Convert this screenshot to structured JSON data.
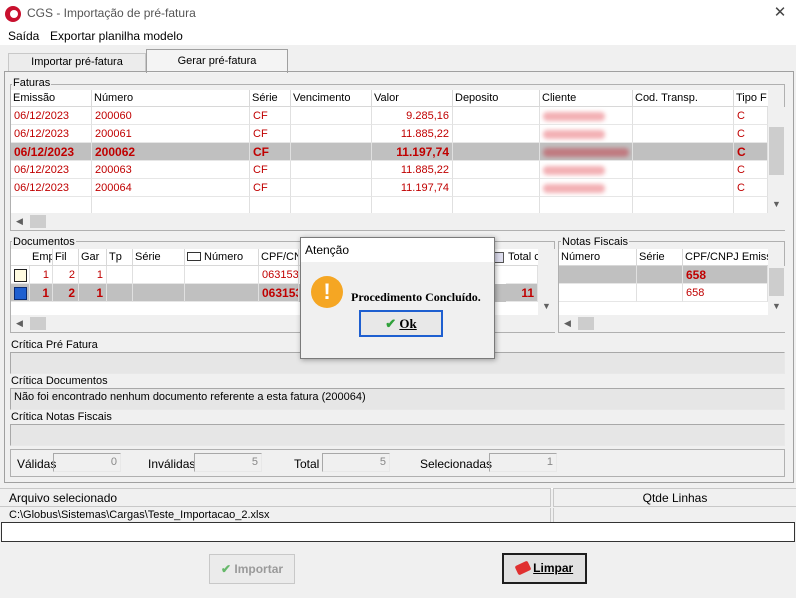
{
  "window": {
    "title": "CGS - Importação de pré-fatura",
    "close_glyph": "✕",
    "icon": "cgs-logo-icon"
  },
  "menu": [
    "Saída",
    "Exportar planilha modelo"
  ],
  "tabs": [
    "Importar pré-fatura",
    "Gerar pré-fatura"
  ],
  "active_tab": "Gerar pré-fatura",
  "faturas": {
    "title": "Faturas",
    "columns": [
      "Emissão",
      "Número",
      "Série",
      "Vencimento",
      "Valor",
      "Deposito",
      "Cliente",
      "Cod. Transp.",
      "Tipo F"
    ],
    "rows": [
      {
        "emissao": "06/12/2023",
        "numero": "200060",
        "serie": "CF",
        "vencimento": "",
        "valor": "9.285,16",
        "deposito": "",
        "cod": "",
        "tipo": "C"
      },
      {
        "emissao": "06/12/2023",
        "numero": "200061",
        "serie": "CF",
        "vencimento": "",
        "valor": "11.885,22",
        "deposito": "",
        "cod": "",
        "tipo": "C"
      },
      {
        "emissao": "06/12/2023",
        "numero": "200062",
        "serie": "CF",
        "vencimento": "",
        "valor": "11.197,74",
        "deposito": "",
        "cod": "",
        "tipo": "C"
      },
      {
        "emissao": "06/12/2023",
        "numero": "200063",
        "serie": "CF",
        "vencimento": "",
        "valor": "11.885,22",
        "deposito": "",
        "cod": "",
        "tipo": "C"
      },
      {
        "emissao": "06/12/2023",
        "numero": "200064",
        "serie": "CF",
        "vencimento": "",
        "valor": "11.197,74",
        "deposito": "",
        "cod": "",
        "tipo": "C"
      }
    ],
    "selected_row": 2
  },
  "documentos": {
    "title": "Documentos",
    "columns": [
      "Emp",
      "Fil",
      "Gar",
      "Tp",
      "Série",
      "Número",
      "CPF/CN",
      "Total c"
    ],
    "rows": [
      {
        "emp": "1",
        "fil": "2",
        "gar": "1",
        "tp": "",
        "serie": "",
        "numero": "",
        "cpf": "063153",
        "total": ""
      },
      {
        "emp": "1",
        "fil": "2",
        "gar": "1",
        "tp": "",
        "serie": "",
        "numero": "",
        "cpf": "063153",
        "total": "11"
      }
    ],
    "selected_row": 1
  },
  "notas": {
    "title": "Notas Fiscais",
    "columns": [
      "Número",
      "Série",
      "CPF/CNPJ Emiss"
    ],
    "rows": [
      {
        "numero": "",
        "serie": "",
        "cpf": "658"
      },
      {
        "numero": "",
        "serie": "",
        "cpf": "658"
      }
    ],
    "selected_row": 0
  },
  "criticas": {
    "pre_fatura_label": "Crítica Pré Fatura",
    "pre_fatura_value": "",
    "documentos_label": "Crítica Documentos",
    "documentos_value": "Não foi encontrado nenhum documento referente a esta fatura (200064)",
    "notas_label": "Crítica Notas Fiscais",
    "notas_value": ""
  },
  "counters": {
    "validas_label": "Válidas",
    "validas": "0",
    "invalidas_label": "Inválidas",
    "invalidas": "5",
    "total_label": "Total",
    "total": "5",
    "selecionadas_label": "Selecionadas",
    "selecionadas": "1"
  },
  "arquivo": {
    "label": "Arquivo selecionado",
    "path": "C:\\Globus\\Sistemas\\Cargas\\Teste_Importacao_2.xlsx",
    "qtde_label": "Qtde Linhas",
    "qtde": ""
  },
  "buttons": {
    "importar": "Importar",
    "limpar": "Limpar"
  },
  "dialog": {
    "title": "Atenção",
    "message": "Procedimento Concluído.",
    "ok": "Ok",
    "icon": "warning-icon"
  },
  "colors": {
    "row_text": "#c00000",
    "selection": "#c0c0c0",
    "accent": "#1e5fd0",
    "warning": "#f5a623"
  }
}
